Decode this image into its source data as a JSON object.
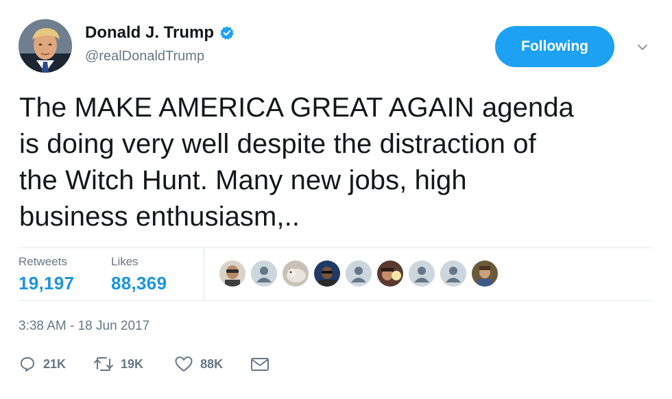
{
  "author": {
    "display_name": "Donald J. Trump",
    "handle": "@realDonaldTrump",
    "verified": true,
    "avatar": "profile-photo"
  },
  "follow_button": {
    "label": "Following"
  },
  "menu": {
    "icon": "chevron-down-icon"
  },
  "tweet": {
    "text": "The MAKE AMERICA GREAT AGAIN agenda\nis doing very well despite the distraction of\nthe Witch Hunt. Many new jobs, high\nbusiness enthusiasm,.."
  },
  "stats": {
    "retweets_label": "Retweets",
    "retweets_value": "19,197",
    "likes_label": "Likes",
    "likes_value": "88,369"
  },
  "likers": [
    {
      "kind": "photo"
    },
    {
      "kind": "default"
    },
    {
      "kind": "photo"
    },
    {
      "kind": "photo"
    },
    {
      "kind": "default"
    },
    {
      "kind": "photo"
    },
    {
      "kind": "default"
    },
    {
      "kind": "default"
    },
    {
      "kind": "photo"
    }
  ],
  "timestamp": "3:38 AM - 18 Jun 2017",
  "actions": {
    "reply": {
      "icon": "reply-icon",
      "count": "21K"
    },
    "retweet": {
      "icon": "retweet-icon",
      "count": "19K"
    },
    "like": {
      "icon": "heart-icon",
      "count": "88K"
    },
    "message": {
      "icon": "envelope-icon"
    }
  },
  "colors": {
    "accent": "#1da1f2",
    "stat_value": "#1b95e0",
    "secondary_text": "#657786",
    "divider": "#e1e8ed"
  }
}
